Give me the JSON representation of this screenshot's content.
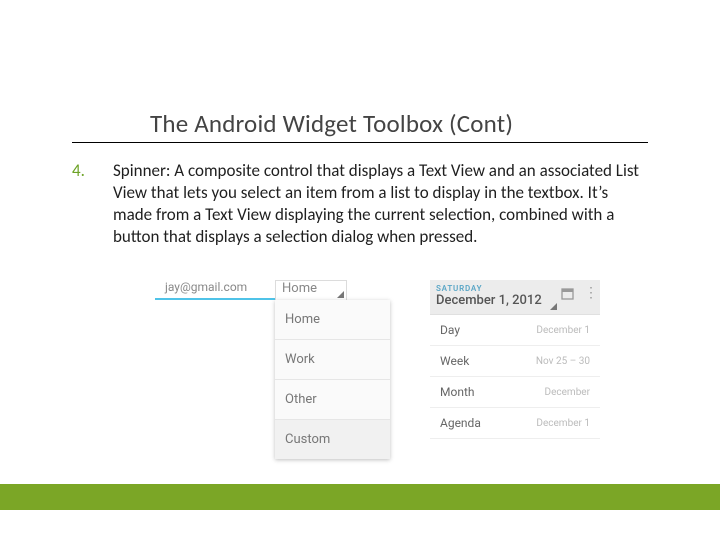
{
  "title": "The Android Widget Toolbox (Cont)",
  "item_number": "4.",
  "body_text": "Spinner:  A composite control that displays a Text View and an associated List View that lets you select an item from a list to display in the textbox. It’s made from a Text View displaying the current selection, combined with a button that displays a selection dialog when pressed.",
  "spinner_sample": {
    "email_value": "jay@gmail.com",
    "selected_label": "Home",
    "options": [
      "Home",
      "Work",
      "Other",
      "Custom"
    ]
  },
  "calendar_sample": {
    "day_of_week": "SATURDAY",
    "date_label": "December 1, 2012",
    "rows": [
      {
        "label": "Day",
        "value": "December 1"
      },
      {
        "label": "Week",
        "value": "Nov 25 – 30"
      },
      {
        "label": "Month",
        "value": "December"
      },
      {
        "label": "Agenda",
        "value": "December 1"
      }
    ]
  }
}
